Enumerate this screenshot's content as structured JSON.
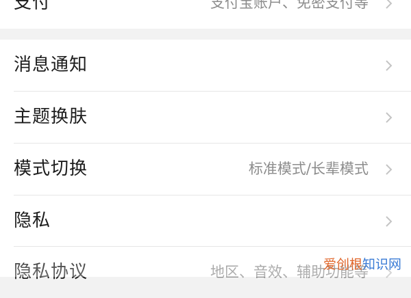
{
  "settings": {
    "payment": {
      "label": "支付",
      "value": "支付宝账户、免密支付等"
    },
    "items": [
      {
        "label": "消息通知",
        "value": ""
      },
      {
        "label": "主题换肤",
        "value": ""
      },
      {
        "label": "模式切换",
        "value": "标准模式/长辈模式"
      },
      {
        "label": "隐私",
        "value": ""
      },
      {
        "label": "隐私协议",
        "value": "地区、音效、辅助功能等"
      }
    ]
  },
  "watermark": {
    "part1": "爱创根",
    "part2": "知识网"
  },
  "colors": {
    "background": "#f2f2f2",
    "card": "#ffffff",
    "label": "#1c1c1c",
    "value": "#8c8c8c",
    "chevron": "#c4c4c4",
    "watermark_orange": "#e0662a",
    "watermark_blue": "#3a7bd5"
  },
  "icons": {
    "chevron": "chevron-right-icon"
  }
}
